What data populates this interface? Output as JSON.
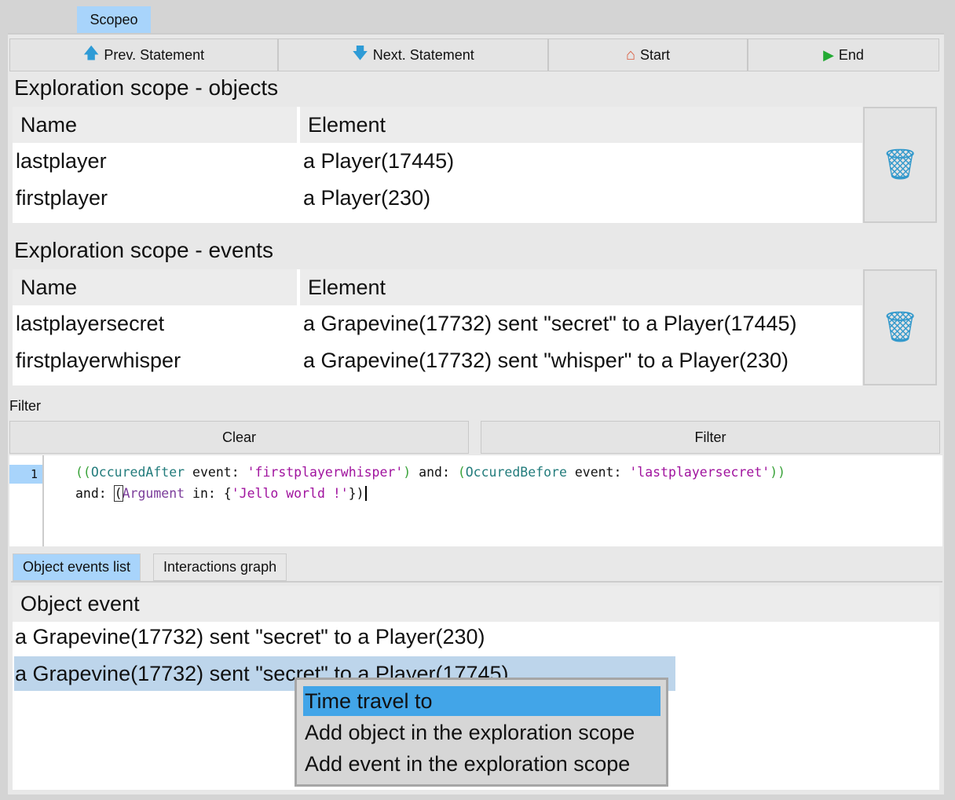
{
  "window_tab": "Scopeo",
  "toolbar": {
    "prev": "Prev. Statement",
    "next": "Next. Statement",
    "start": "Start",
    "end": "End"
  },
  "objects_scope": {
    "title": "Exploration scope - objects",
    "columns": [
      "Name",
      "Element"
    ],
    "rows": [
      {
        "name": "lastplayer",
        "element": "a Player(17445)"
      },
      {
        "name": "firstplayer",
        "element": "a Player(230)"
      }
    ]
  },
  "events_scope": {
    "title": "Exploration scope - events",
    "columns": [
      "Name",
      "Element"
    ],
    "rows": [
      {
        "name": "lastplayersecret",
        "element": "a Grapevine(17732) sent \"secret\" to a Player(17445)"
      },
      {
        "name": "firstplayerwhisper",
        "element": "a Grapevine(17732) sent \"whisper\" to a Player(230)"
      }
    ]
  },
  "filter": {
    "label": "Filter",
    "clear": "Clear",
    "filter": "Filter",
    "line_number": "1",
    "code": {
      "t1": "OccuredAfter",
      "t2": " event: ",
      "t3": "'firstplayerwhisper'",
      "t4": " and: ",
      "t5": "OccuredBefore",
      "t6": " event: ",
      "t7": "'lastplayersecret'",
      "t8": "and: ",
      "t9": "Argument",
      "t10": " in: {",
      "t11": "'Jello world !'",
      "t12": "})"
    }
  },
  "bottom_tabs": [
    "Object events list",
    "Interactions graph"
  ],
  "events_list": {
    "header": "Object event",
    "rows": [
      "a Grapevine(17732) sent \"secret\" to a Player(230)",
      "a Grapevine(17732) sent \"secret\" to a Player(17745)"
    ],
    "selected_index": 1
  },
  "context_menu": [
    "Time travel to",
    "Add object in the exploration scope",
    "Add event in the exploration scope"
  ],
  "colors": {
    "accent": "#a8d4fb",
    "menu_highlight": "#42a5e8",
    "selection": "#bdd5eb",
    "icon_blue": "#3399cc"
  }
}
